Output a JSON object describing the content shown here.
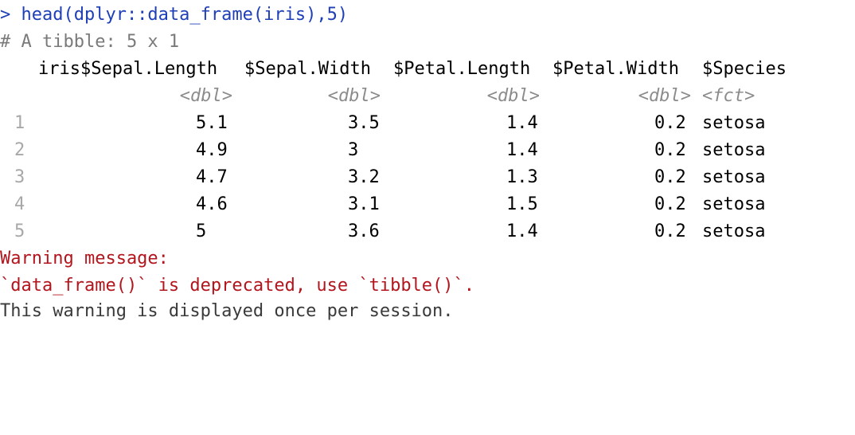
{
  "console": {
    "command": "> head(dplyr::data_frame(iris),5)",
    "tibble_header": "# A tibble: 5 x 1",
    "columns": [
      {
        "name": "iris$Sepal.Length",
        "type": "<dbl>"
      },
      {
        "name": "$Sepal.Width",
        "type": "<dbl>"
      },
      {
        "name": "$Petal.Length",
        "type": "<dbl>"
      },
      {
        "name": "$Petal.Width",
        "type": "<dbl>"
      },
      {
        "name": "$Species",
        "type": "<fct>"
      }
    ],
    "rows": [
      {
        "index": "1",
        "cells": [
          "5.1",
          "3.5",
          "1.4",
          "0.2",
          "setosa"
        ]
      },
      {
        "index": "2",
        "cells": [
          "4.9",
          "3",
          "1.4",
          "0.2",
          "setosa"
        ]
      },
      {
        "index": "3",
        "cells": [
          "4.7",
          "3.2",
          "1.3",
          "0.2",
          "setosa"
        ]
      },
      {
        "index": "4",
        "cells": [
          "4.6",
          "3.1",
          "1.5",
          "0.2",
          "setosa"
        ]
      },
      {
        "index": "5",
        "cells": [
          "5",
          "3.6",
          "1.4",
          "0.2",
          "setosa"
        ]
      }
    ],
    "warning_title": "Warning message:",
    "warning_text": "`data_frame()` is deprecated, use `tibble()`.",
    "info_text": "This warning is displayed once per session."
  },
  "colors": {
    "prompt": "#1f3fb7",
    "comment": "#7a7a7a",
    "type_hint": "#8c8c8c",
    "row_index": "#a8a8a8",
    "warning": "#b3151d",
    "info": "#3a3a3a"
  }
}
